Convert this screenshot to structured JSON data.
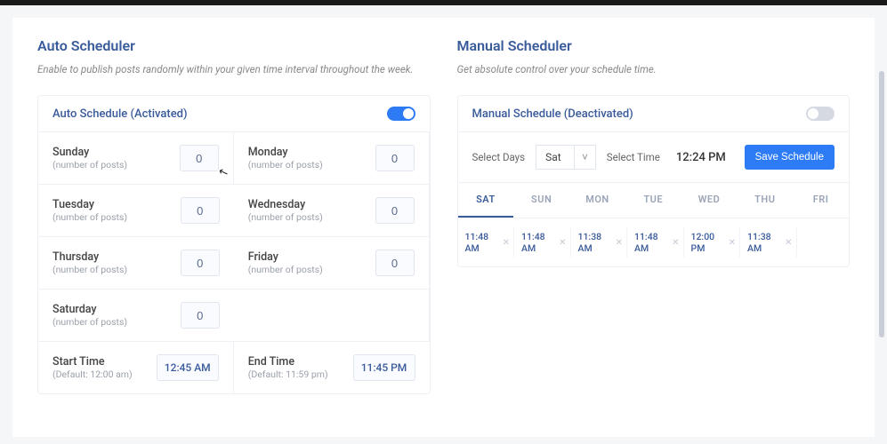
{
  "auto": {
    "title": "Auto Scheduler",
    "subtitle": "Enable to publish posts randomly within your given time interval throughout the week.",
    "status_label": "Auto Schedule (Activated)",
    "toggle_on": true,
    "days": [
      {
        "name": "Sunday",
        "sub": "(number of posts)",
        "value": "0"
      },
      {
        "name": "Monday",
        "sub": "(number of posts)",
        "value": "0"
      },
      {
        "name": "Tuesday",
        "sub": "(number of posts)",
        "value": "0"
      },
      {
        "name": "Wednesday",
        "sub": "(number of posts)",
        "value": "0"
      },
      {
        "name": "Thursday",
        "sub": "(number of posts)",
        "value": "0"
      },
      {
        "name": "Friday",
        "sub": "(number of posts)",
        "value": "0"
      },
      {
        "name": "Saturday",
        "sub": "(number of posts)",
        "value": "0"
      }
    ],
    "start": {
      "label": "Start Time",
      "sub": "(Default: 12:00 am)",
      "value": "12:45 AM"
    },
    "end": {
      "label": "End Time",
      "sub": "(Default: 11:59 pm)",
      "value": "11:45 PM"
    }
  },
  "manual": {
    "title": "Manual Scheduler",
    "subtitle": "Get absolute control over your schedule time.",
    "status_label": "Manual Schedule (Deactivated)",
    "toggle_on": false,
    "select_days_label": "Select Days",
    "select_days_value": "Sat",
    "select_time_label": "Select Time",
    "select_time_value": "12:24 PM",
    "save_label": "Save Schedule",
    "tabs": [
      "SAT",
      "SUN",
      "MON",
      "TUE",
      "WED",
      "THU",
      "FRI"
    ],
    "active_tab": 0,
    "times": [
      "11:48 AM",
      "11:48 AM",
      "11:38 AM",
      "11:48 AM",
      "12:00 PM",
      "11:38 AM"
    ]
  }
}
